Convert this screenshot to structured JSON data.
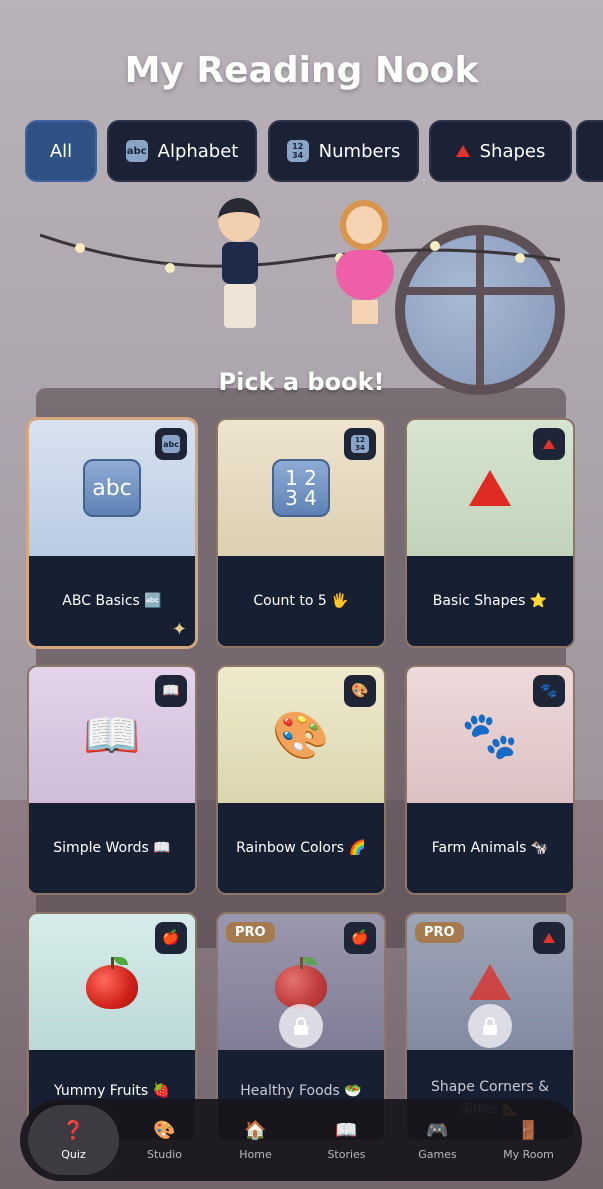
{
  "title": "My Reading Nook",
  "tabs": [
    {
      "label": "All",
      "icon": "",
      "active": true
    },
    {
      "label": "Alphabet",
      "icon": "abc-icon",
      "active": false
    },
    {
      "label": "Numbers",
      "icon": "numbers-1234-icon",
      "active": false
    },
    {
      "label": "Shapes",
      "icon": "red-triangle-icon",
      "active": false
    }
  ],
  "prompt": "Pick a book!",
  "books": [
    {
      "label": "ABC Basics 🔤",
      "badge_icon": "abc-icon",
      "art_icon": "abc-key-icon",
      "art_text": "abc",
      "pro": false,
      "locked": false,
      "selected": true,
      "bg": "#c9d7ea"
    },
    {
      "label": "Count to 5 🖐",
      "badge_icon": "numbers-1234-icon",
      "art_icon": "numbers-key-icon",
      "art_text": "12\n34",
      "pro": false,
      "locked": false,
      "selected": false,
      "bg": "#e6ddc6"
    },
    {
      "label": "Basic Shapes ⭐",
      "badge_icon": "red-triangle-icon",
      "art_icon": "red-triangle-icon",
      "art_text": "",
      "pro": false,
      "locked": false,
      "selected": false,
      "bg": "#cfdcc8"
    },
    {
      "label": "Simple Words 📖",
      "badge_icon": "open-book-icon",
      "art_icon": "open-book-icon",
      "art_text": "📖",
      "pro": false,
      "locked": false,
      "selected": false,
      "bg": "#dccae2"
    },
    {
      "label": "Rainbow Colors 🌈",
      "badge_icon": "palette-icon",
      "art_icon": "palette-icon",
      "art_text": "🎨",
      "pro": false,
      "locked": false,
      "selected": false,
      "bg": "#e6e1c2"
    },
    {
      "label": "Farm Animals 🐄",
      "badge_icon": "paw-prints-icon",
      "art_icon": "paw-prints-icon",
      "art_text": "🐾",
      "pro": false,
      "locked": false,
      "selected": false,
      "bg": "#e7cfd1"
    },
    {
      "label": "Yummy Fruits 🍓",
      "badge_icon": "apple-icon",
      "art_icon": "apple-icon",
      "art_text": "",
      "pro": false,
      "locked": false,
      "selected": false,
      "bg": "#cbe4e3"
    },
    {
      "label": "Healthy Foods 🥗",
      "badge_icon": "apple-icon",
      "art_icon": "apple-icon",
      "art_text": "",
      "pro": true,
      "locked": true,
      "selected": false,
      "bg": "#8d8aa3"
    },
    {
      "label": "Shape Corners & Sides 📐",
      "badge_icon": "red-triangle-icon",
      "art_icon": "red-triangle-icon",
      "art_text": "",
      "pro": true,
      "locked": true,
      "selected": false,
      "bg": "#8f97ad"
    }
  ],
  "pro_label": "PRO",
  "nav": [
    {
      "label": "Quiz",
      "icon": "question-book-icon",
      "glyph": "❓",
      "active": true
    },
    {
      "label": "Studio",
      "icon": "palette-icon",
      "glyph": "🎨",
      "active": false
    },
    {
      "label": "Home",
      "icon": "house-icon",
      "glyph": "🏠",
      "active": false
    },
    {
      "label": "Stories",
      "icon": "book-icon",
      "glyph": "📖",
      "active": false
    },
    {
      "label": "Games",
      "icon": "gamepad-icon",
      "glyph": "🎮",
      "active": false
    },
    {
      "label": "My Room",
      "icon": "door-icon",
      "glyph": "🚪",
      "active": false
    }
  ],
  "colors": {
    "accent": "#2f5184",
    "card_dark": "#172033",
    "pro_badge": "#a47a4e",
    "selected_border": "#d6a67d"
  }
}
